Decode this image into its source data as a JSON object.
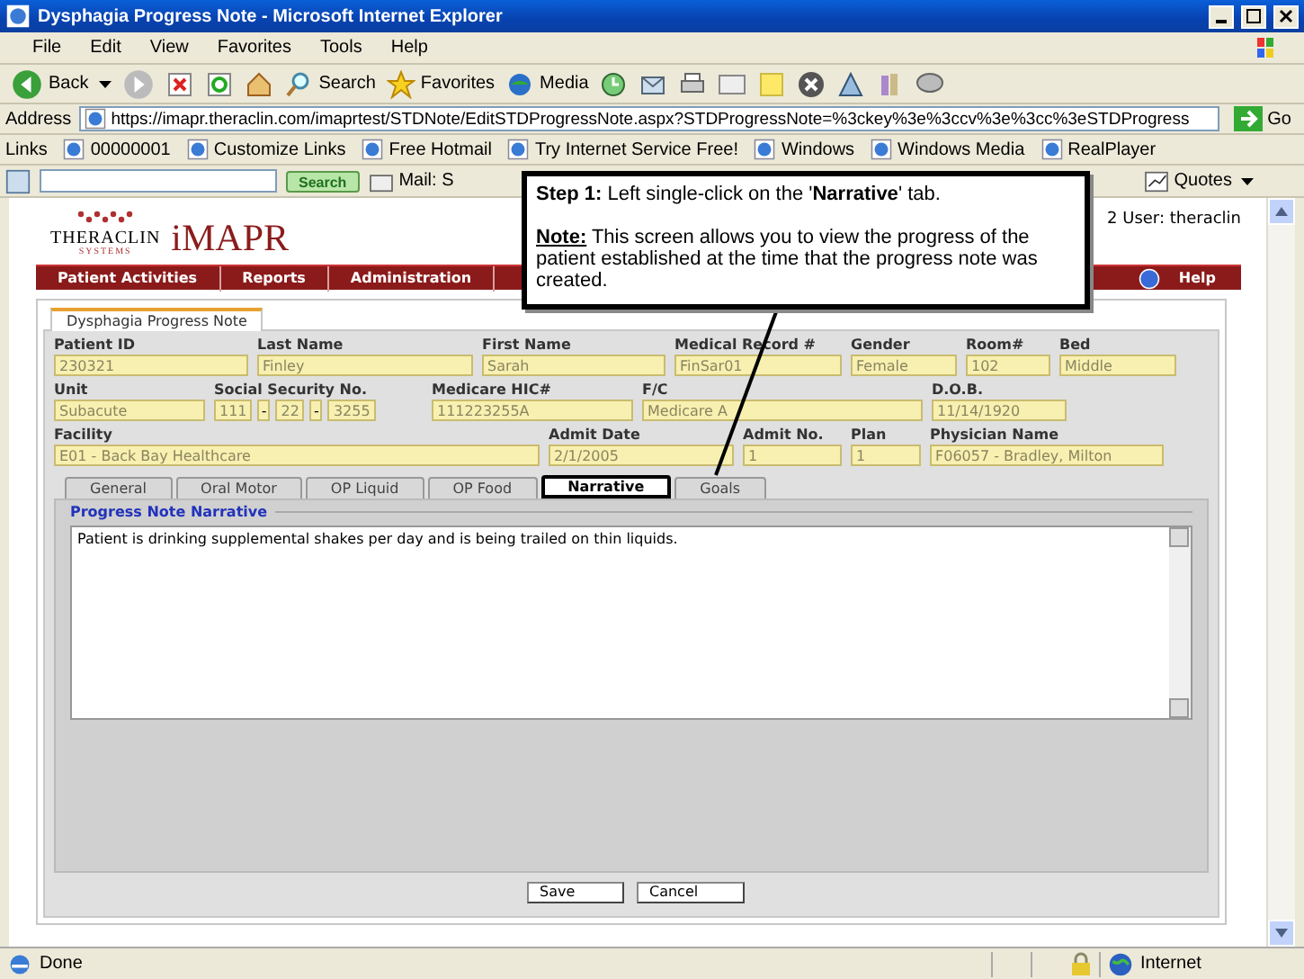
{
  "window": {
    "title": "Dysphagia Progress Note - Microsoft Internet Explorer"
  },
  "menu": [
    "File",
    "Edit",
    "View",
    "Favorites",
    "Tools",
    "Help"
  ],
  "toolbar": {
    "back": "Back",
    "search": "Search",
    "favorites": "Favorites",
    "media": "Media"
  },
  "address": {
    "label": "Address",
    "url": "https://imapr.theraclin.com/imaprtest/STDNote/EditSTDProgressNote.aspx?STDProgressNote=%3ckey%3e%3ccv%3e%3cc%3eSTDProgress",
    "go": "Go"
  },
  "links": {
    "label": "Links",
    "items": [
      "00000001",
      "Customize Links",
      "Free Hotmail",
      "Try Internet Service Free!",
      "Windows",
      "Windows Media",
      "RealPlayer"
    ]
  },
  "search_bar": {
    "button": "Search",
    "mail": "Mail: S",
    "quotes": "Quotes"
  },
  "app": {
    "logo_brand": "THERACLIN",
    "logo_sub": "SYSTEMS",
    "logo_product": "iMAPR",
    "user": "2 User: theraclin",
    "nav": [
      "Patient Activities",
      "Reports",
      "Administration"
    ],
    "help": "Help"
  },
  "form": {
    "tab": "Dysphagia Progress Note",
    "rows": [
      [
        {
          "kind": "text",
          "label": "Patient ID",
          "value": "230321"
        },
        {
          "kind": "text",
          "label": "Last Name",
          "value": "Finley"
        },
        {
          "kind": "text",
          "label": "First Name",
          "value": "Sarah"
        },
        {
          "kind": "text",
          "label": "Medical Record #",
          "value": "FinSar01"
        },
        {
          "kind": "text",
          "label": "Gender",
          "value": "Female"
        },
        {
          "kind": "text",
          "label": "Room#",
          "value": "102"
        },
        {
          "kind": "text",
          "label": "Bed",
          "value": "Middle"
        }
      ],
      [
        {
          "kind": "text",
          "label": "Unit",
          "value": "Subacute"
        },
        {
          "kind": "split",
          "label": "Social Security No.",
          "parts": [
            "111",
            "22",
            "3255"
          ],
          "separator": "-"
        },
        {
          "kind": "text",
          "label": "Medicare HIC#",
          "value": "111223255A"
        },
        {
          "kind": "text",
          "label": "F/C",
          "value": "Medicare A"
        },
        {
          "kind": "text",
          "label": "D.O.B.",
          "value": "11/14/1920"
        }
      ],
      [
        {
          "kind": "text",
          "label": "Facility",
          "value": "E01 - Back Bay Healthcare"
        },
        {
          "kind": "text",
          "label": "Admit Date",
          "value": "2/1/2005"
        },
        {
          "kind": "text",
          "label": "Admit No.",
          "value": "1"
        },
        {
          "kind": "text",
          "label": "Plan",
          "value": "1"
        },
        {
          "kind": "text",
          "label": "Physician Name",
          "value": "F06057 - Bradley, Milton"
        }
      ]
    ],
    "tabs": [
      {
        "label": "General",
        "selected": false
      },
      {
        "label": "Oral Motor",
        "selected": false
      },
      {
        "label": "OP Liquid",
        "selected": false
      },
      {
        "label": "OP Food",
        "selected": false
      },
      {
        "label": "Narrative",
        "selected": true
      },
      {
        "label": "Goals",
        "selected": false
      }
    ],
    "section_title": "Progress Note Narrative",
    "narrative": "Patient is drinking supplemental shakes per day and is being trailed on thin liquids.",
    "buttons": [
      "Save",
      "Cancel"
    ]
  },
  "callout": {
    "step": "**Step 1:** Left single-click on the '**Narrative**' tab.",
    "note": "**Note:** This screen allows you to view the progress of the patient established at the time that the progress note was created."
  },
  "status_bar": {
    "text": "Done",
    "zone": "Internet"
  }
}
